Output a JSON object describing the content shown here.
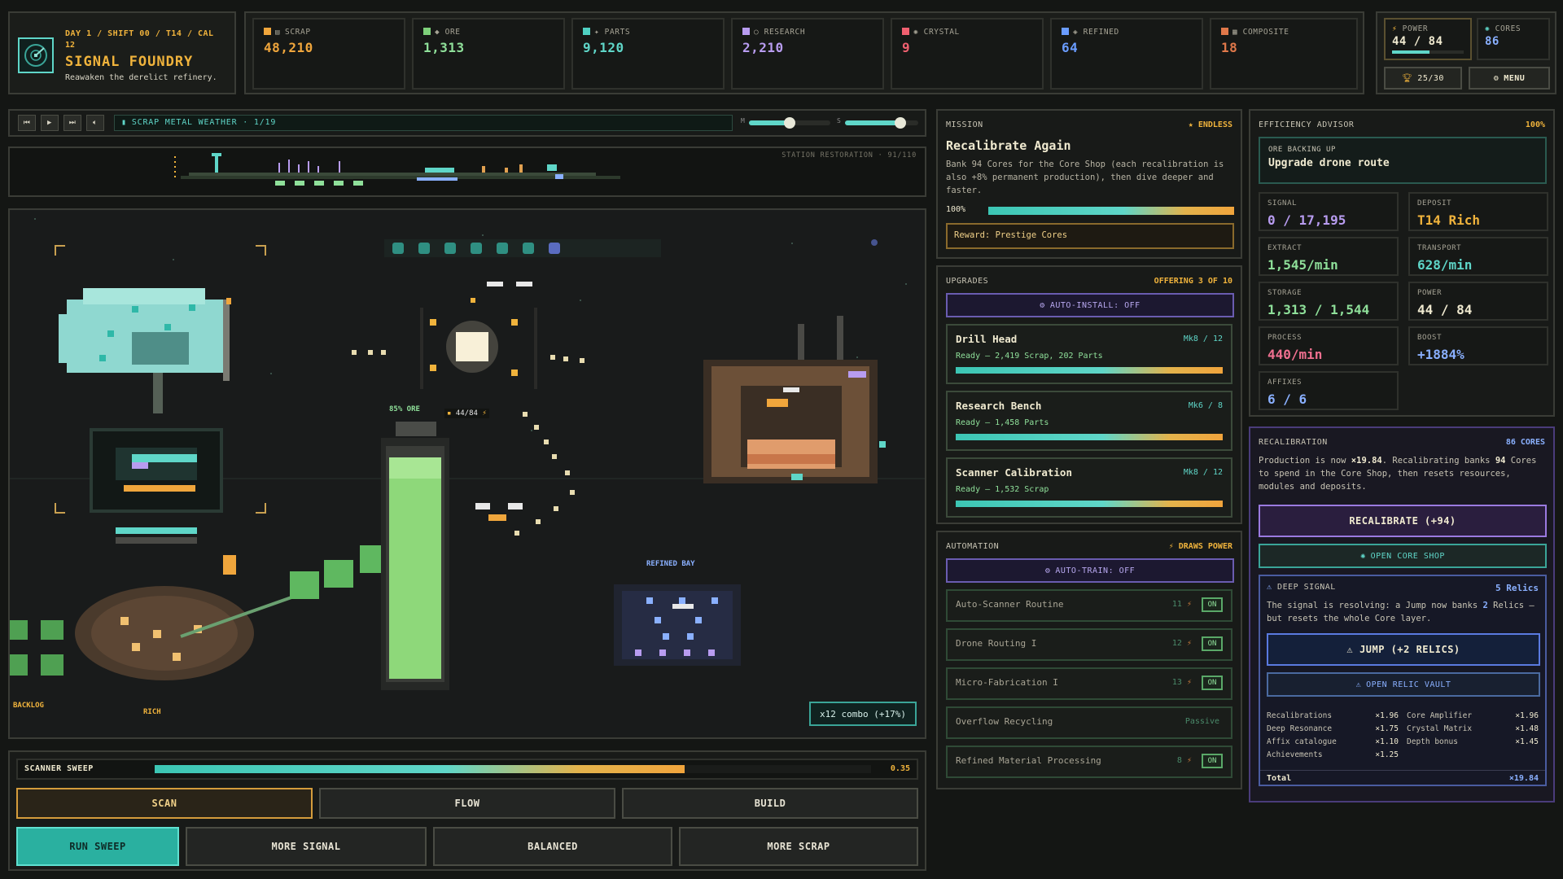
{
  "header": {
    "day_line": "DAY 1 / SHIFT 00 / T14 / CAL",
    "day_line2": "12",
    "title": "SIGNAL FOUNDRY",
    "subtitle": "Reawaken the derelict refinery."
  },
  "resources": [
    {
      "name": "SCRAP",
      "value": "48,210",
      "color": "#f0a63c"
    },
    {
      "name": "ORE",
      "value": "1,313",
      "color": "#7ed07a"
    },
    {
      "name": "PARTS",
      "value": "9,120",
      "color": "#4fd0c2"
    },
    {
      "name": "RESEARCH",
      "value": "2,210",
      "color": "#b89cf0"
    },
    {
      "name": "CRYSTAL",
      "value": "9",
      "color": "#f06070"
    },
    {
      "name": "REFINED",
      "value": "64",
      "color": "#6a9cff"
    },
    {
      "name": "COMPOSITE",
      "value": "18",
      "color": "#e0784a"
    }
  ],
  "power_box": {
    "label": "POWER",
    "value": "44 / 84",
    "fill": 0.52
  },
  "cores_box": {
    "label": "CORES",
    "value": "86"
  },
  "trophy_btn": "25/30",
  "menu_btn": "MENU",
  "music": {
    "track": "SCRAP METAL WEATHER · 1/19",
    "m_label": "M",
    "s_label": "S",
    "m_level": 0.5,
    "s_level": 0.75
  },
  "station": {
    "label": "STATION RESTORATION · 91/110"
  },
  "scene": {
    "ore_pct": "85% ORE",
    "power_tag": "44/84",
    "refined_bay": "REFINED BAY",
    "backlog": "BACKLOG",
    "rich": "RICH",
    "combo": "x12 combo (+17%)"
  },
  "sweep": {
    "label": "SCANNER SWEEP",
    "value": "0.35",
    "fill": 0.74
  },
  "modes": [
    "SCAN",
    "FLOW",
    "BUILD"
  ],
  "actions": [
    "RUN SWEEP",
    "MORE SIGNAL",
    "BALANCED",
    "MORE SCRAP"
  ],
  "mission": {
    "header": "MISSION",
    "tag": "ENDLESS",
    "title": "Recalibrate Again",
    "desc": "Bank 94 Cores for the Core Shop (each recalibration is also +8% permanent production), then dive deeper and faster.",
    "pct": "100%",
    "fill": 1.0,
    "reward": "Reward: Prestige Cores"
  },
  "upgrades": {
    "header": "UPGRADES",
    "offering": "OFFERING 3 OF 10",
    "auto": "AUTO-INSTALL: OFF",
    "items": [
      {
        "name": "Drill Head",
        "mk": "Mk8 / 12",
        "cost": "Ready — 2,419 Scrap, 202 Parts",
        "fill": 1.0
      },
      {
        "name": "Research Bench",
        "mk": "Mk6 / 8",
        "cost": "Ready — 1,458 Parts",
        "fill": 1.0
      },
      {
        "name": "Scanner Calibration",
        "mk": "Mk8 / 12",
        "cost": "Ready — 1,532 Scrap",
        "fill": 1.0
      }
    ]
  },
  "automation": {
    "header": "AUTOMATION",
    "draws": "DRAWS POWER",
    "auto": "AUTO-TRAIN: OFF",
    "items": [
      {
        "name": "Auto-Scanner Routine",
        "cost": "11",
        "state": "ON"
      },
      {
        "name": "Drone Routing I",
        "cost": "12",
        "state": "ON"
      },
      {
        "name": "Micro-Fabrication I",
        "cost": "13",
        "state": "ON"
      },
      {
        "name": "Overflow Recycling",
        "cost": "",
        "state": "Passive"
      },
      {
        "name": "Refined Material Processing",
        "cost": "8",
        "state": "ON"
      }
    ]
  },
  "advisor": {
    "header": "EFFICIENCY ADVISOR",
    "pct": "100%",
    "hint_k": "ORE BACKING UP",
    "hint_v": "Upgrade drone route",
    "stats": [
      {
        "k": "SIGNAL",
        "v": "0 / 17,195",
        "color": "#b89cf0"
      },
      {
        "k": "DEPOSIT",
        "v": "T14 Rich",
        "color": "#f0b33c"
      },
      {
        "k": "EXTRACT",
        "v": "1,545/min",
        "color": "#8fe09a"
      },
      {
        "k": "TRANSPORT",
        "v": "628/min",
        "color": "#5fd6c8"
      },
      {
        "k": "STORAGE",
        "v": "1,313 / 1,544",
        "color": "#8fe09a"
      },
      {
        "k": "POWER",
        "v": "44 / 84",
        "color": "#f0ead0"
      },
      {
        "k": "PROCESS",
        "v": "440/min",
        "color": "#f07090"
      },
      {
        "k": "BOOST",
        "v": "+1884%",
        "color": "#8ab0ff"
      },
      {
        "k": "AFFIXES",
        "v": "6 / 6",
        "color": "#8ab0ff"
      }
    ]
  },
  "recal": {
    "header": "RECALIBRATION",
    "cores": "86 CORES",
    "desc_a": "Production is now ",
    "desc_mult": "×19.84",
    "desc_b": ". Recalibrating banks ",
    "desc_n": "94",
    "desc_c": " Cores to spend in the Core Shop, then resets resources, modules and deposits.",
    "btn": "RECALIBRATE (+94)",
    "shop": "OPEN CORE SHOP",
    "deep_title": "DEEP SIGNAL",
    "deep_relics": "5 Relics",
    "deep_desc_a": "The signal is resolving: a Jump now banks ",
    "deep_desc_n": "2",
    "deep_desc_b": " Relics — but resets the whole Core layer.",
    "jump": "JUMP (+2 RELICS)",
    "vault": "OPEN RELIC VAULT",
    "mults": [
      {
        "k": "Recalibrations",
        "v": "×1.96"
      },
      {
        "k": "Core Amplifier",
        "v": "×1.96"
      },
      {
        "k": "Deep Resonance",
        "v": "×1.75"
      },
      {
        "k": "Crystal Matrix",
        "v": "×1.48"
      },
      {
        "k": "Affix catalogue",
        "v": "×1.10"
      },
      {
        "k": "Depth bonus",
        "v": "×1.45"
      },
      {
        "k": "Achievements",
        "v": "×1.25"
      }
    ],
    "total_k": "Total",
    "total_v": "×19.84"
  }
}
